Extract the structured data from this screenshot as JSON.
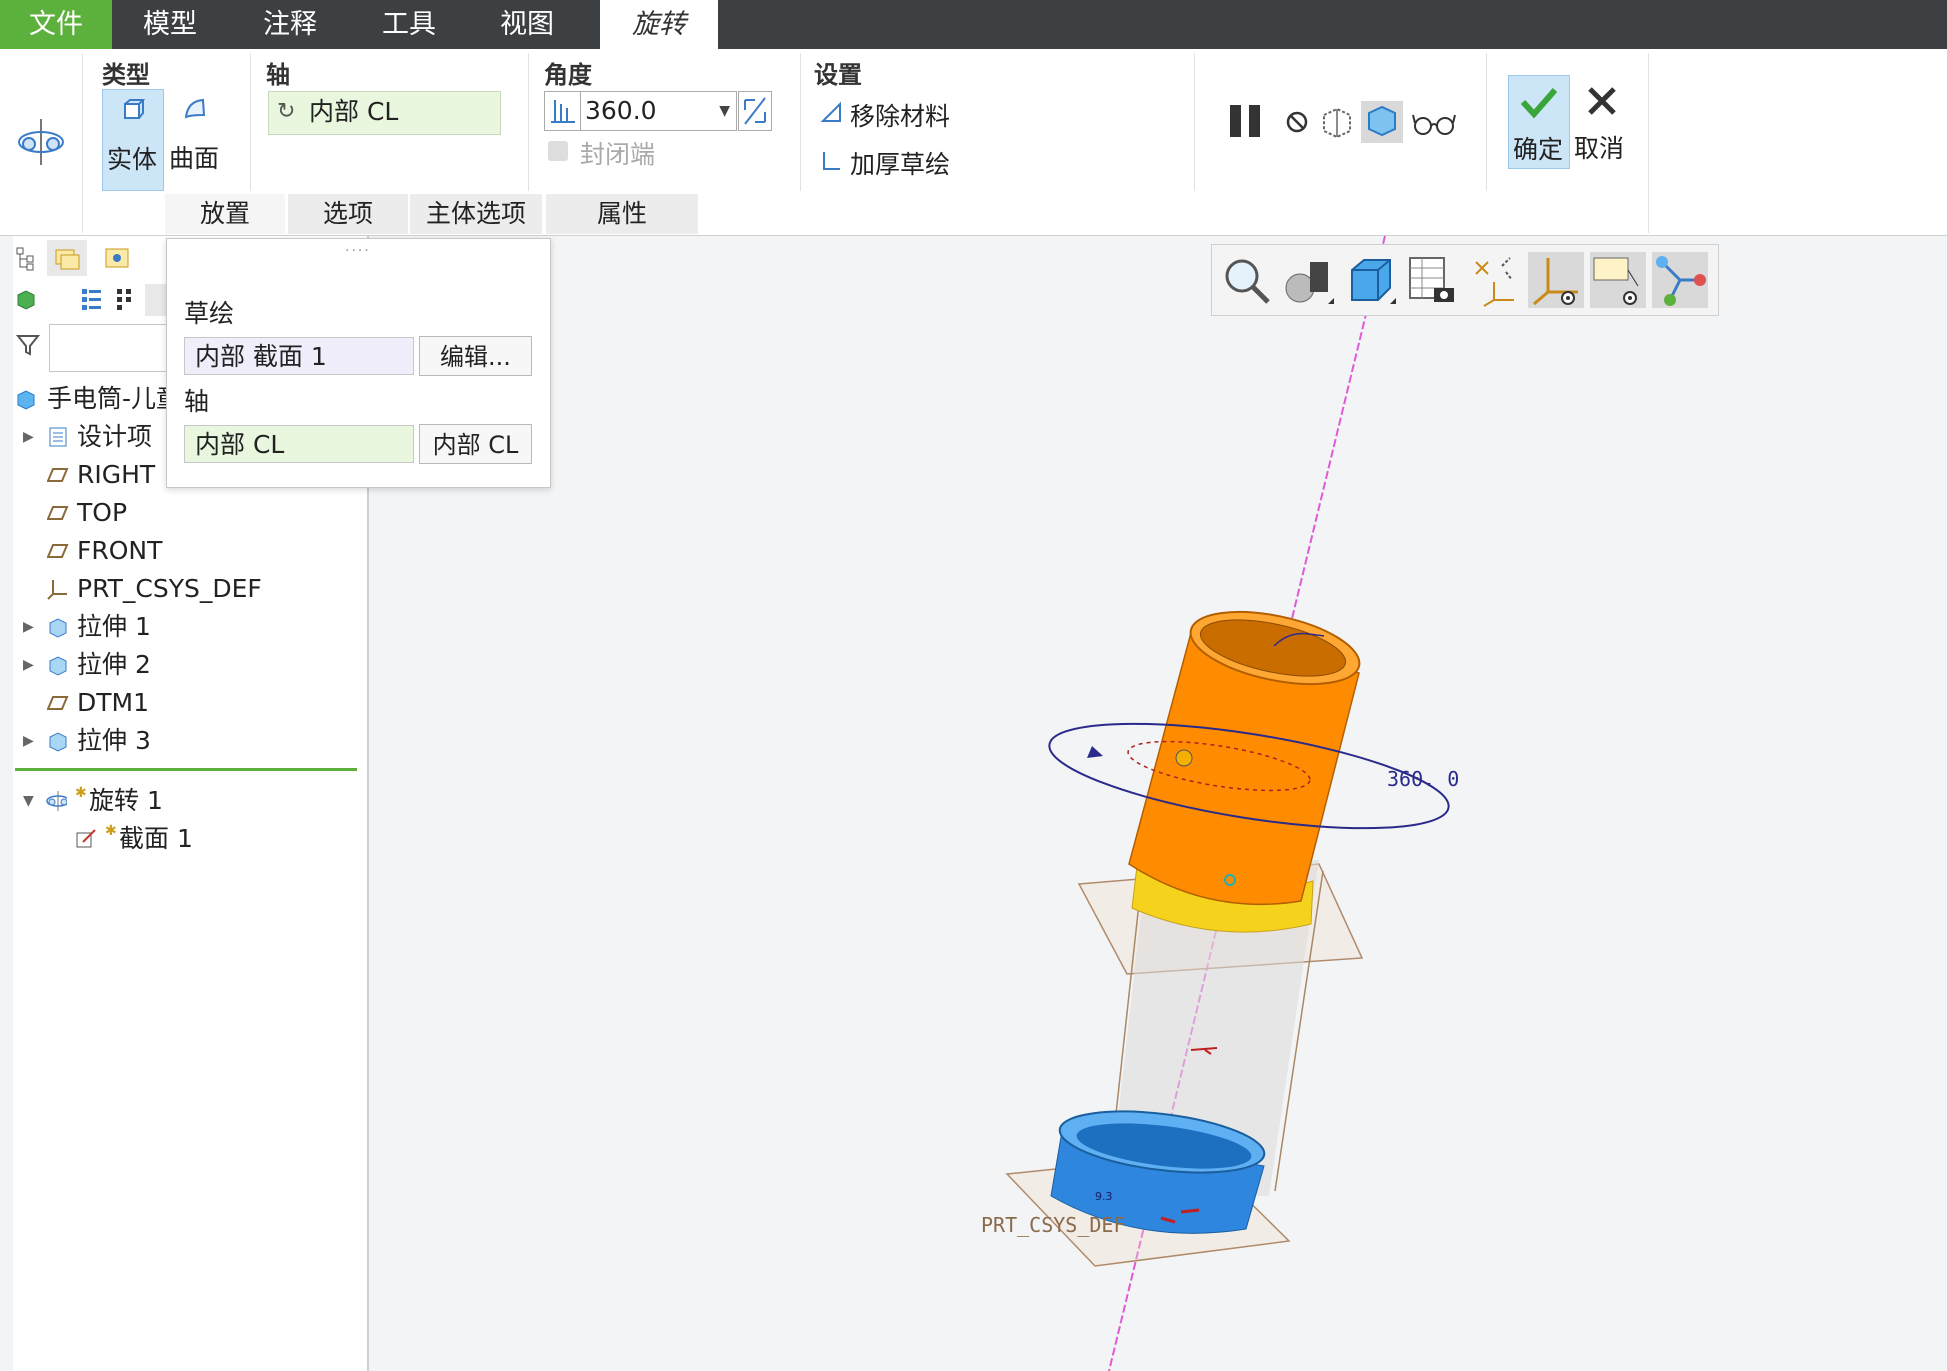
{
  "menu": {
    "file": "文件",
    "model": "模型",
    "annotate": "注释",
    "tools": "工具",
    "view": "视图",
    "revolve": "旋转"
  },
  "ribbon": {
    "type_title": "类型",
    "solid": "实体",
    "surface": "曲面",
    "axis_title": "轴",
    "axis_value": "内部 CL",
    "angle_title": "角度",
    "angle_value": "360.0",
    "cap_ends": "封闭端",
    "settings_title": "设置",
    "remove_material": "移除材料",
    "thicken_sketch": "加厚草绘",
    "ok": "确定",
    "cancel": "取消",
    "subtabs": [
      "放置",
      "选项",
      "主体选项",
      "属性"
    ]
  },
  "popup": {
    "sketch_label": "草绘",
    "sketch_value": "内部 截面 1",
    "edit_button": "编辑...",
    "axis_label": "轴",
    "axis_value": "内部 CL",
    "axis_button": "内部 CL"
  },
  "tree": {
    "root": "手电筒-儿童",
    "items": [
      "设计项",
      "RIGHT",
      "TOP",
      "FRONT",
      "PRT_CSYS_DEF",
      "拉伸 1",
      "拉伸 2",
      "DTM1",
      "拉伸 3"
    ],
    "revolve": "旋转 1",
    "section": "截面 1"
  },
  "viewport": {
    "dimension_label": "360. 0",
    "csys_label": "PRT_CSYS_DEF",
    "small_dim": "9.3"
  },
  "colors": {
    "accent_green": "#5cb03c",
    "menubar": "#3c4043",
    "orange_body": "#ff8c00",
    "yellow_ring": "#f5d31c",
    "blue_base": "#2e86de",
    "axis_line": "#e05ad6"
  }
}
